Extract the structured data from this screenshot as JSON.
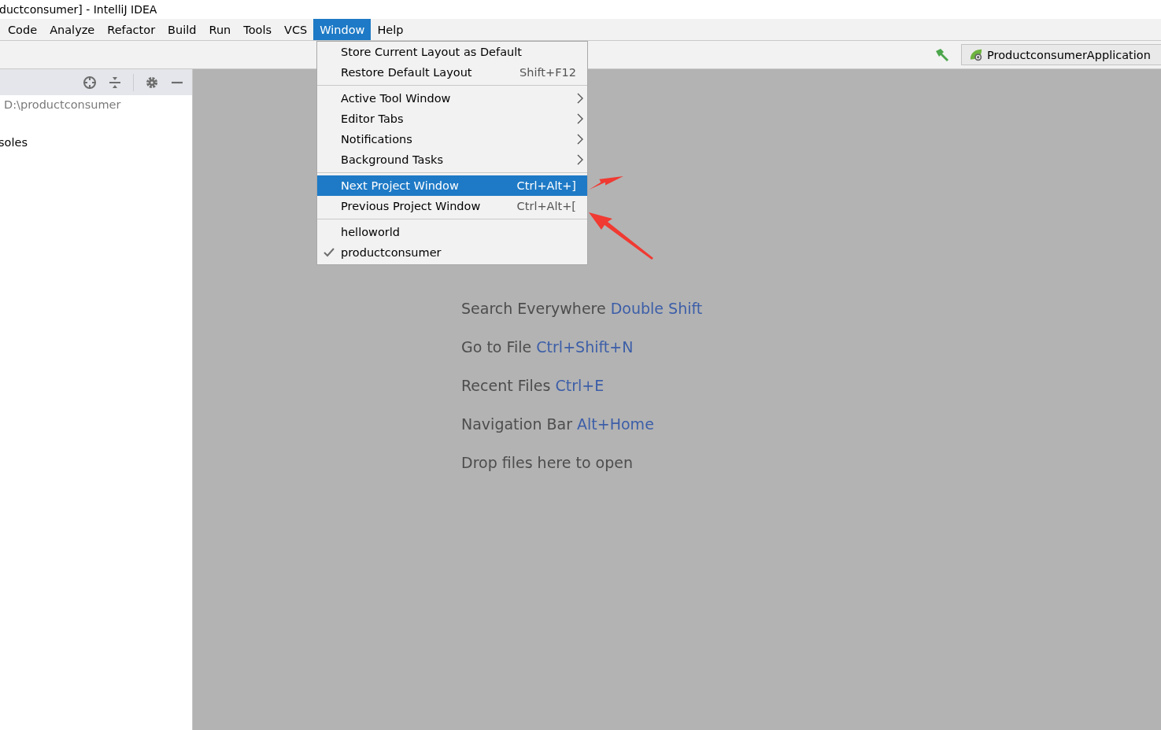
{
  "window": {
    "title": "ductconsumer] - IntelliJ IDEA"
  },
  "menu_bar": [
    {
      "label": "Code",
      "selected": false
    },
    {
      "label": "Analyze",
      "selected": false
    },
    {
      "label": "Refactor",
      "selected": false
    },
    {
      "label": "Build",
      "selected": false
    },
    {
      "label": "Run",
      "selected": false
    },
    {
      "label": "Tools",
      "selected": false
    },
    {
      "label": "VCS",
      "selected": false
    },
    {
      "label": "Window",
      "selected": true
    },
    {
      "label": "Help",
      "selected": false
    }
  ],
  "toolbar": {
    "run_configuration": "ProductconsumerApplication"
  },
  "project_panel": {
    "items": [
      "D:\\productconsumer",
      "soles"
    ]
  },
  "window_menu": {
    "groups": [
      [
        {
          "label": "Store Current Layout as Default",
          "submenu": false,
          "selected": false,
          "checked": false
        },
        {
          "label": "Restore Default Layout",
          "shortcut": "Shift+F12",
          "submenu": false,
          "selected": false,
          "checked": false
        }
      ],
      [
        {
          "label": "Active Tool Window",
          "submenu": true,
          "selected": false,
          "checked": false
        },
        {
          "label": "Editor Tabs",
          "submenu": true,
          "selected": false,
          "checked": false
        },
        {
          "label": "Notifications",
          "submenu": true,
          "selected": false,
          "checked": false
        },
        {
          "label": "Background Tasks",
          "submenu": true,
          "selected": false,
          "checked": false
        }
      ],
      [
        {
          "label": "Next Project Window",
          "shortcut": "Ctrl+Alt+]",
          "submenu": false,
          "selected": true,
          "checked": false
        },
        {
          "label": "Previous Project Window",
          "shortcut": "Ctrl+Alt+[",
          "submenu": false,
          "selected": false,
          "checked": false
        }
      ],
      [
        {
          "label": "helloworld",
          "submenu": false,
          "selected": false,
          "checked": false
        },
        {
          "label": "productconsumer",
          "submenu": false,
          "selected": false,
          "checked": true
        }
      ]
    ]
  },
  "editor_hints": [
    {
      "label": "Search Everywhere",
      "shortcut": "Double Shift"
    },
    {
      "label": "Go to File",
      "shortcut": "Ctrl+Shift+N"
    },
    {
      "label": "Recent Files",
      "shortcut": "Ctrl+E"
    },
    {
      "label": "Navigation Bar",
      "shortcut": "Alt+Home"
    },
    {
      "label": "Drop files here to open"
    }
  ],
  "annotations": [
    {
      "kind": "arrow"
    },
    {
      "kind": "arrow"
    }
  ]
}
